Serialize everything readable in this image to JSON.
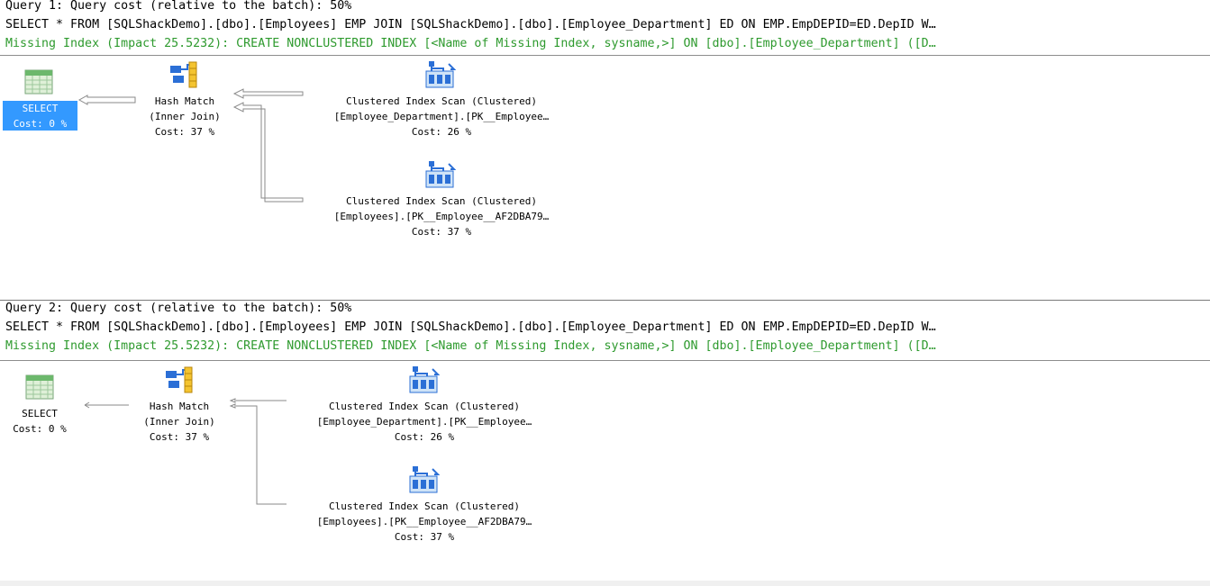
{
  "colors": {
    "missing_index": "#2e9a2e",
    "selection": "#3399ff",
    "divider": "#8d8d8d"
  },
  "queries": [
    {
      "header": "Query 1: Query cost (relative to the batch): 50%",
      "sql": "SELECT * FROM [SQLShackDemo].[dbo].[Employees] EMP JOIN [SQLShackDemo].[dbo].[Employee_Department] ED ON EMP.EmpDEPID=ED.DepID W…",
      "missing_index": "Missing Index (Impact 25.5232): CREATE NONCLUSTERED INDEX [<Name of Missing Index, sysname,>] ON [dbo].[Employee_Department] ([D…",
      "nodes": {
        "select": {
          "icon": "select-icon",
          "label": "SELECT",
          "cost": "Cost: 0 %",
          "selected": true
        },
        "hash": {
          "icon": "hash-match-icon",
          "label": "Hash Match",
          "sub": "(Inner Join)",
          "cost": "Cost: 37 %"
        },
        "scan1": {
          "icon": "clustered-index-scan-icon",
          "label": "Clustered Index Scan (Clustered)",
          "object": "[Employee_Department].[PK__Employee…",
          "cost": "Cost: 26 %"
        },
        "scan2": {
          "icon": "clustered-index-scan-icon",
          "label": "Clustered Index Scan (Clustered)",
          "object": "[Employees].[PK__Employee__AF2DBA79…",
          "cost": "Cost: 37 %"
        }
      }
    },
    {
      "header": "Query 2: Query cost (relative to the batch): 50%",
      "sql": "SELECT * FROM [SQLShackDemo].[dbo].[Employees] EMP JOIN [SQLShackDemo].[dbo].[Employee_Department] ED ON EMP.EmpDEPID=ED.DepID W…",
      "missing_index": "Missing Index (Impact 25.5232): CREATE NONCLUSTERED INDEX [<Name of Missing Index, sysname,>] ON [dbo].[Employee_Department] ([D…",
      "nodes": {
        "select": {
          "icon": "select-icon",
          "label": "SELECT",
          "cost": "Cost: 0 %",
          "selected": false
        },
        "hash": {
          "icon": "hash-match-icon",
          "label": "Hash Match",
          "sub": "(Inner Join)",
          "cost": "Cost: 37 %"
        },
        "scan1": {
          "icon": "clustered-index-scan-icon",
          "label": "Clustered Index Scan (Clustered)",
          "object": "[Employee_Department].[PK__Employee…",
          "cost": "Cost: 26 %"
        },
        "scan2": {
          "icon": "clustered-index-scan-icon",
          "label": "Clustered Index Scan (Clustered)",
          "object": "[Employees].[PK__Employee__AF2DBA79…",
          "cost": "Cost: 37 %"
        }
      }
    }
  ]
}
